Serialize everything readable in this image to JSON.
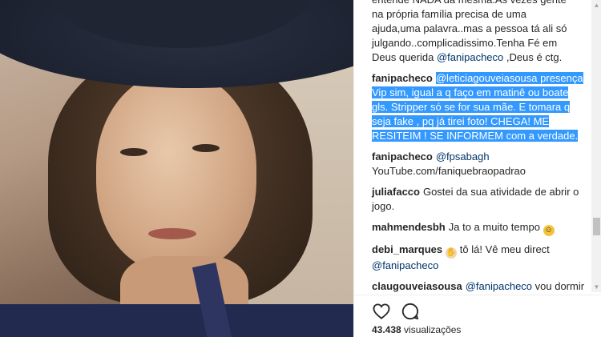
{
  "comments": [
    {
      "user": "",
      "text_lines": [
        "entende NADA da mesma.Ás vezes gente",
        "na própria família precisa de uma",
        "ajuda,uma palavra..mas a pessoa tá ali só",
        "julgando..complicadissimo.Tenha Fé em"
      ],
      "tail_prefix": "Deus querida ",
      "tail_mention": "@fanipacheco",
      "tail_suffix": " ,Deus é ctg."
    },
    {
      "user": "fanipacheco",
      "mention": "@leticiagouveiasousa",
      "text": " presença Vip sim, igual a q faço em matinê ou boate gls. Stripper só se for sua mãe. E tomara q seja fake , pq já tirei foto! CHEGA! ME RESITEIM ! SE INFORMEM com a verdade."
    },
    {
      "user": "fanipacheco",
      "mention": "@fpsabagh",
      "text": "YouTube.com/faniquebraopadrao"
    },
    {
      "user": "juliafacco",
      "text": "Gostei da sua atividade de abrir o jogo."
    },
    {
      "user": "mahmendesbh",
      "text": "Ja to a muito tempo"
    },
    {
      "user": "debi_marques",
      "text": "tô lá! Vê meu direct",
      "mention": "@fanipacheco"
    },
    {
      "user": "claugouveiasousa",
      "mention": "@fanipacheco",
      "text": " vou dormir na pia com sua opiniao..kd o"
    }
  ],
  "views": {
    "count": "43.438",
    "label": "visualizações"
  },
  "icons": {
    "like": "heart-icon",
    "comment": "comment-bubble-icon"
  },
  "colors": {
    "selection": "#3399ff",
    "mention": "#003569"
  }
}
